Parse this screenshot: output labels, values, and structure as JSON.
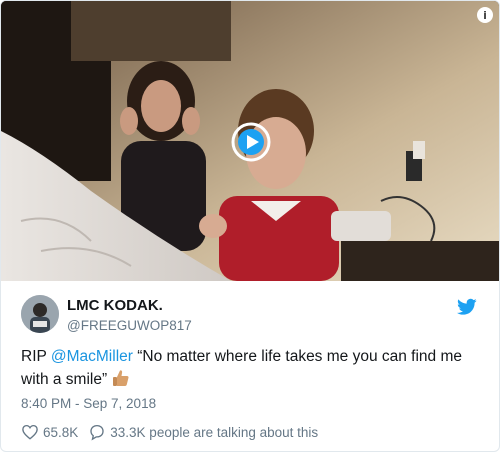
{
  "tweet": {
    "display_name": "LMC KODAK.",
    "handle": "@FREEGUWOP817",
    "text_prefix": "RIP ",
    "mention": "@MacMiller",
    "text_suffix": " “No matter where life takes me you can find me with a smile”",
    "timestamp": "8:40 PM - Sep 7, 2018",
    "likes": "65.8K",
    "talking": "33.3K people are talking about this",
    "info_glyph": "i"
  },
  "icons": {
    "play": "play-icon",
    "info": "info-icon",
    "bird": "twitter-bird-icon",
    "heart": "heart-icon",
    "reply": "speech-bubble-icon",
    "emoji": "thumbs-up-emoji"
  },
  "colors": {
    "accent": "#1da1f2",
    "mention": "#1b95e0",
    "secondary_text": "#657786",
    "primary_text": "#14171a"
  }
}
